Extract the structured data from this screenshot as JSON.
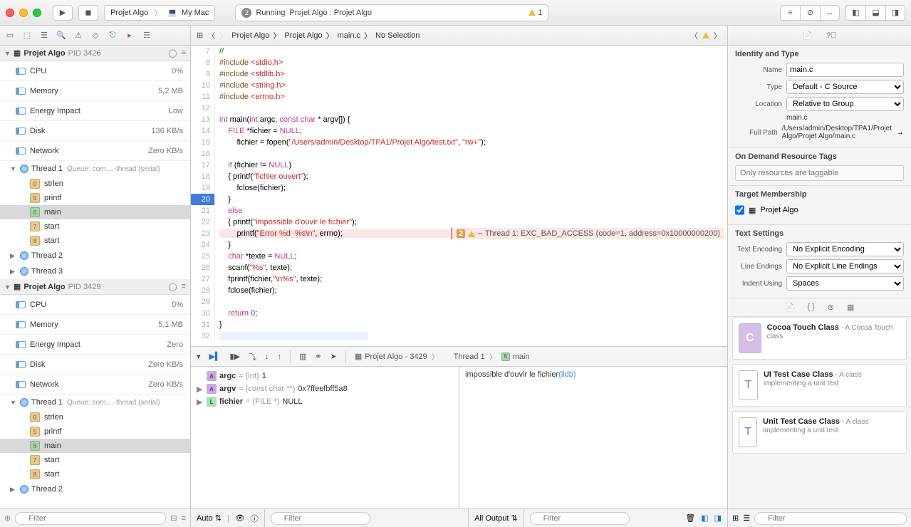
{
  "titlebar": {
    "scheme_app": "Projet Algo",
    "scheme_dest": "My Mac",
    "status_prefix": "Running",
    "status_text": "Projet Algo : Projet Algo",
    "warn_count": "1",
    "count_badge": "2"
  },
  "jumpbar": {
    "project": "Projet Algo",
    "folder": "Projet Algo",
    "file": "main.c",
    "selection": "No Selection"
  },
  "proc1": {
    "name": "Projet Algo",
    "pid": "PID 3426",
    "cpu_label": "CPU",
    "cpu_val": "0%",
    "mem_label": "Memory",
    "mem_val": "5,2 MB",
    "energy_label": "Energy Impact",
    "energy_val": "Low",
    "disk_label": "Disk",
    "disk_val": "136 KB/s",
    "net_label": "Network",
    "net_val": "Zero KB/s",
    "thread1_name": "Thread 1",
    "thread1_detail": "Queue: com....-thread (serial)",
    "thread2_name": "Thread 2",
    "thread3_name": "Thread 3",
    "frames": [
      {
        "n": "0",
        "label": "strlen"
      },
      {
        "n": "5",
        "label": "printf"
      },
      {
        "n": "6",
        "label": "main"
      },
      {
        "n": "7",
        "label": "start"
      },
      {
        "n": "8",
        "label": "start"
      }
    ]
  },
  "proc2": {
    "name": "Projet Algo",
    "pid": "PID 3429",
    "cpu_label": "CPU",
    "cpu_val": "0%",
    "mem_label": "Memory",
    "mem_val": "5,1 MB",
    "energy_label": "Energy Impact",
    "energy_val": "Zero",
    "disk_label": "Disk",
    "disk_val": "Zero KB/s",
    "net_label": "Network",
    "net_val": "Zero KB/s",
    "thread1_name": "Thread 1",
    "thread1_detail": "Queue: com....-thread (serial)",
    "thread2_name": "Thread 2",
    "frames": [
      {
        "n": "0",
        "label": "strlen"
      },
      {
        "n": "5",
        "label": "printf"
      },
      {
        "n": "6",
        "label": "main"
      },
      {
        "n": "7",
        "label": "start"
      },
      {
        "n": "8",
        "label": "start"
      }
    ]
  },
  "editor": {
    "error_badge": "2",
    "error_text": "Thread 1: EXC_BAD_ACCESS (code=1, address=0x10000000200)"
  },
  "debug_bc": {
    "target": "Projet Algo - 3429",
    "thread": "Thread 1",
    "frame_n": "6",
    "frame": "main"
  },
  "vars": {
    "argc_name": "argc",
    "argc_type": "= (int)",
    "argc_val": "1",
    "argv_name": "argv",
    "argv_type": "= (const char **)",
    "argv_val": "0x7ffeefbff5a8",
    "fichier_name": "fichier",
    "fichier_type": "= (FILE *)",
    "fichier_val": "NULL"
  },
  "console": {
    "output": "impossible d'ouvir le fichier",
    "prompt": "(lldb)"
  },
  "bottombar": {
    "auto": "Auto",
    "all_output": "All Output",
    "filter_ph": "Filter"
  },
  "inspector": {
    "identity_h": "Identity and Type",
    "name_l": "Name",
    "name_v": "main.c",
    "type_l": "Type",
    "type_v": "Default - C Source",
    "loc_l": "Location",
    "loc_v": "Relative to Group",
    "loc_file": "main.c",
    "fullpath_l": "Full Path",
    "fullpath_v": "/Users/admin/Desktop/TPA1/Projet Algo/Projet Algo/main.c",
    "ondemand_h": "On Demand Resource Tags",
    "ondemand_ph": "Only resources are taggable",
    "target_h": "Target Membership",
    "target_name": "Projet Algo",
    "text_h": "Text Settings",
    "enc_l": "Text Encoding",
    "enc_v": "No Explicit Encoding",
    "le_l": "Line Endings",
    "le_v": "No Explicit Line Endings",
    "indent_l": "Indent Using",
    "indent_v": "Spaces"
  },
  "library": [
    {
      "title": "Cocoa Touch Class",
      "desc": "- A Cocoa Touch class",
      "glyph": "C",
      "cls": "c"
    },
    {
      "title": "UI Test Case Class",
      "desc": "- A class implementing a unit test",
      "glyph": "T",
      "cls": ""
    },
    {
      "title": "Unit Test Case Class",
      "desc": "- A class implementing a unit test",
      "glyph": "T",
      "cls": ""
    }
  ]
}
